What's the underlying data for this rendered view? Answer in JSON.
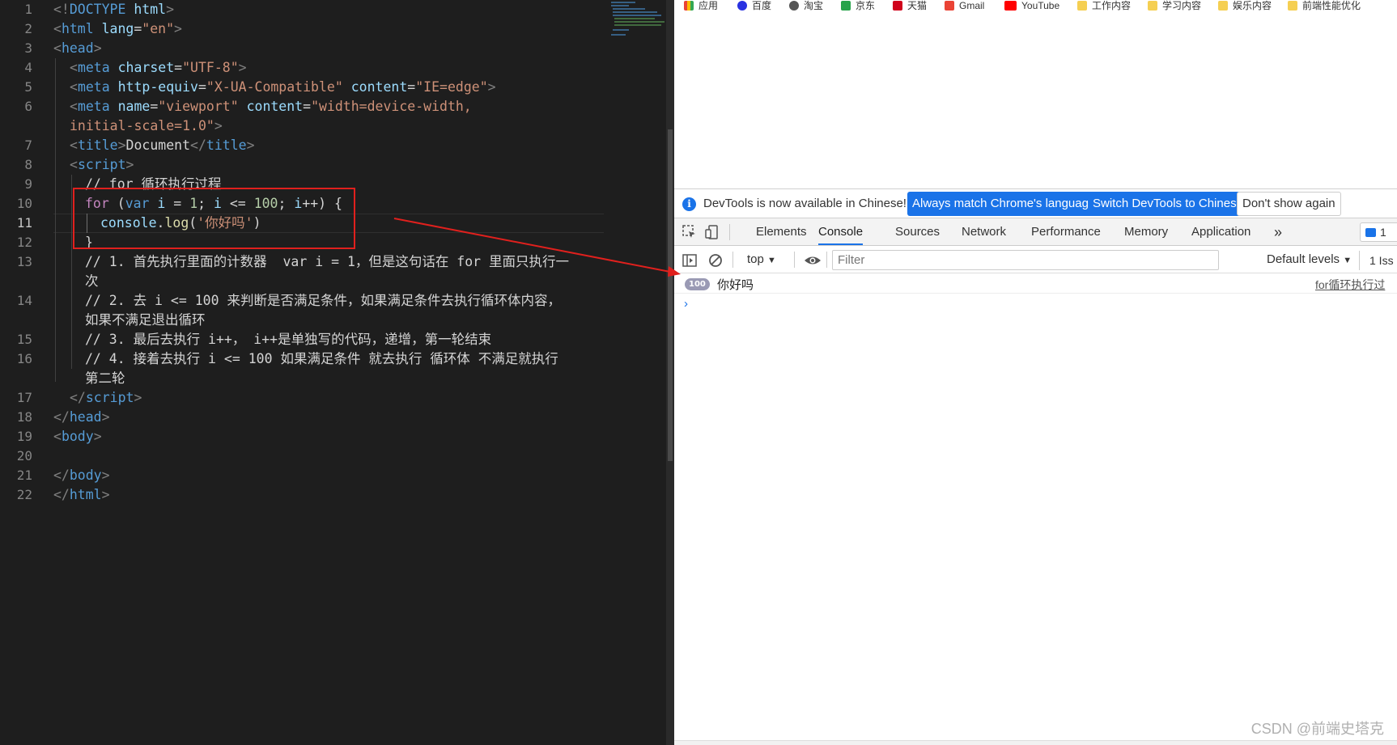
{
  "editor": {
    "line_numbers": [
      "1",
      "2",
      "3",
      "4",
      "5",
      "6",
      "7",
      "8",
      "9",
      "10",
      "11",
      "12",
      "13",
      "14",
      "15",
      "16",
      "17",
      "18",
      "19",
      "20",
      "21",
      "22"
    ],
    "l1": {
      "a": "<!",
      "b": "DOCTYPE",
      "c": " html",
      "d": ">"
    },
    "l2": {
      "a": "<",
      "b": "html",
      "c": " lang",
      "d": "=",
      "e": "\"en\"",
      "f": ">"
    },
    "l3": {
      "a": "<",
      "b": "head",
      "c": ">"
    },
    "l4": {
      "a": "<",
      "b": "meta",
      "c": " charset",
      "d": "=",
      "e": "\"UTF-8\"",
      "f": ">"
    },
    "l5": {
      "a": "<",
      "b": "meta",
      "c": " http-equiv",
      "d": "=",
      "e": "\"X-UA-Compatible\"",
      "f": " content",
      "g": "=",
      "h": "\"IE=edge\"",
      "i": ">"
    },
    "l6": {
      "a": "<",
      "b": "meta",
      "c": " name",
      "d": "=",
      "e": "\"viewport\"",
      "f": " content",
      "g": "=",
      "h": "\"width=device-width,"
    },
    "l6w": {
      "a": "initial-scale=1.0\"",
      "b": ">"
    },
    "l7": {
      "a": "<",
      "b": "title",
      "c": ">",
      "d": "Document",
      "e": "</",
      "f": "title",
      "g": ">"
    },
    "l8": {
      "a": "<",
      "b": "script",
      "c": ">"
    },
    "l9": "// for 循环执行过程",
    "l10": {
      "a": "for",
      "b": " (",
      "c": "var",
      "d": " i",
      "e": " = ",
      "f": "1",
      "g": "; ",
      "h": "i",
      "i": " <= ",
      "j": "100",
      "k": "; ",
      "l": "i",
      "m": "++) {"
    },
    "l11": {
      "a": "console",
      "b": ".",
      "c": "log",
      "d": "(",
      "e": "'你好吗'",
      "f": ")"
    },
    "l12": "}",
    "l13": "// 1. 首先执行里面的计数器  var i = 1，但是这句话在 for 里面只执行一",
    "l13w": "次",
    "l14": "// 2. 去 i <= 100 来判断是否满足条件，如果满足条件去执行循环体内容，",
    "l14w": "如果不满足退出循环",
    "l15": "// 3. 最后去执行 i++， i++是单独写的代码，递增，第一轮结束",
    "l16": "// 4. 接着去执行 i <= 100 如果满足条件 就去执行 循环体 不满足就执行",
    "l16w": "第二轮",
    "l17": {
      "a": "</",
      "b": "script",
      "c": ">"
    },
    "l18": {
      "a": "</",
      "b": "head",
      "c": ">"
    },
    "l19": {
      "a": "<",
      "b": "body",
      "c": ">"
    },
    "l21": {
      "a": "</",
      "b": "body",
      "c": ">"
    },
    "l22": {
      "a": "</",
      "b": "html",
      "c": ">"
    }
  },
  "bookmarks": {
    "apps": "应用",
    "baidu": "百度",
    "taobao": "淘宝",
    "jd": "京东",
    "tmall": "天猫",
    "gmail": "Gmail",
    "youtube": "YouTube",
    "work": "工作内容",
    "study": "学习内容",
    "fun": "娱乐内容",
    "perf": "前端性能优化"
  },
  "devtools": {
    "info_text": "DevTools is now available in Chinese!",
    "btn_match": "Always match Chrome's language",
    "btn_switch": "Switch DevTools to Chinese",
    "btn_dismiss": "Don't show again",
    "tabs": [
      "Elements",
      "Console",
      "Sources",
      "Network",
      "Performance",
      "Memory",
      "Application"
    ],
    "more": "»",
    "issues_badge": "1",
    "context": "top",
    "filter_placeholder": "Filter",
    "levels": "Default levels",
    "issues_count": "1 Iss",
    "log_count": "100",
    "log_message": "你好吗",
    "log_source": "for循环执行过",
    "prompt": "›"
  },
  "watermark": "CSDN @前端史塔克",
  "colors": {
    "accent": "#1a73e8",
    "annotation": "#e0201d",
    "editor_bg": "#1e1e1e"
  }
}
